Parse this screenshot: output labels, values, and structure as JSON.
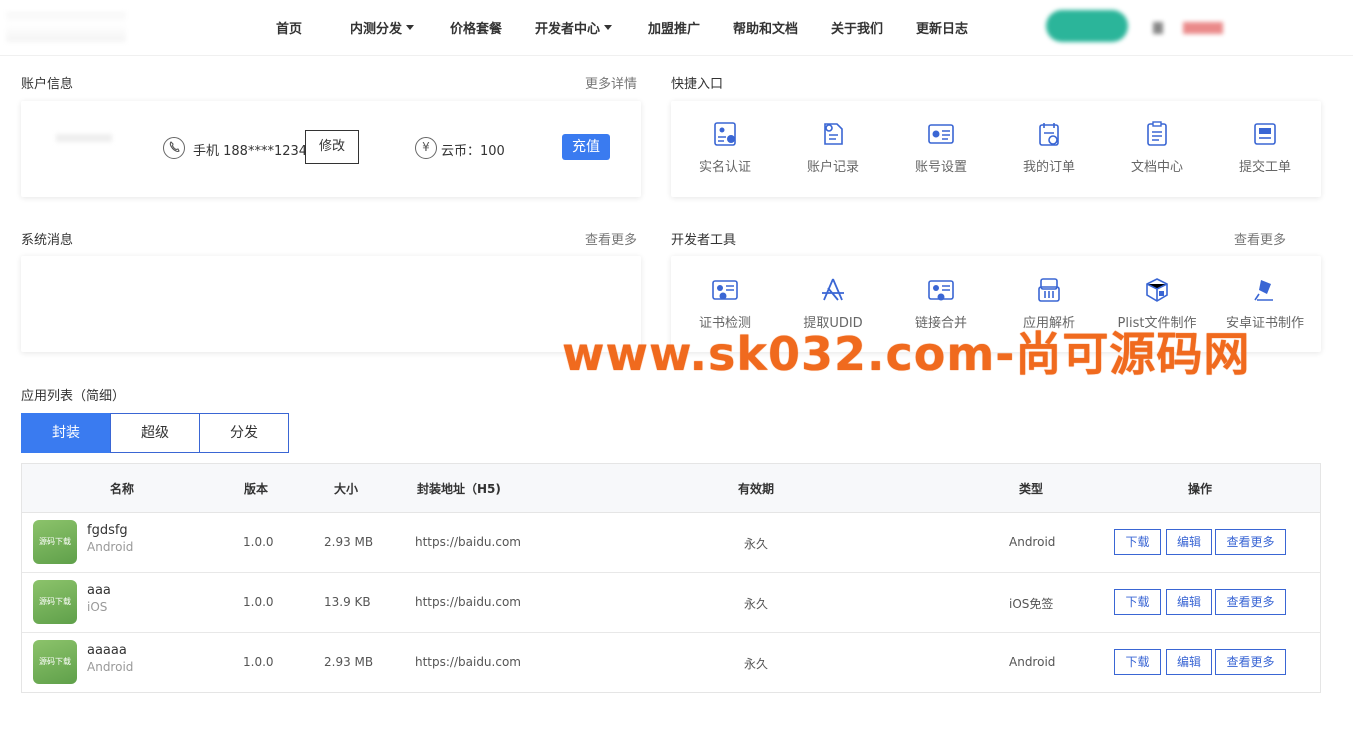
{
  "nav": {
    "items": [
      {
        "label": "首页"
      },
      {
        "label": "内测分发",
        "dropdown": true
      },
      {
        "label": "价格套餐"
      },
      {
        "label": "开发者中心",
        "dropdown": true
      },
      {
        "label": "加盟推广"
      },
      {
        "label": "帮助和文档"
      },
      {
        "label": "关于我们"
      },
      {
        "label": "更新日志"
      }
    ]
  },
  "account": {
    "title": "账户信息",
    "more": "更多详情",
    "phone_icon": "phone-icon",
    "phone_text": "手机 188****1234",
    "edit_label": "修改",
    "coin_icon": "yen-icon",
    "coin_text": "云币：100",
    "recharge_label": "充值"
  },
  "quick": {
    "title": "快捷入口",
    "items": [
      {
        "label": "实名认证",
        "icon": "id-verify-icon"
      },
      {
        "label": "账户记录",
        "icon": "account-record-icon"
      },
      {
        "label": "账号设置",
        "icon": "account-settings-icon"
      },
      {
        "label": "我的订单",
        "icon": "order-icon"
      },
      {
        "label": "文档中心",
        "icon": "document-icon"
      },
      {
        "label": "提交工单",
        "icon": "ticket-icon"
      }
    ]
  },
  "messages": {
    "title": "系统消息",
    "more": "查看更多"
  },
  "devtools": {
    "title": "开发者工具",
    "more": "查看更多",
    "items": [
      {
        "label": "证书检测",
        "icon": "certificate-check-icon"
      },
      {
        "label": "提取UDID",
        "icon": "app-store-icon"
      },
      {
        "label": "链接合并",
        "icon": "link-merge-icon"
      },
      {
        "label": "应用解析",
        "icon": "app-parse-icon"
      },
      {
        "label": "Plist文件制作",
        "icon": "plist-icon"
      },
      {
        "label": "安卓证书制作",
        "icon": "android-cert-icon"
      }
    ]
  },
  "watermark": "www.sk032.com-尚可源码网",
  "applist": {
    "title": "应用列表（简细）",
    "tabs": [
      {
        "label": "封装",
        "active": true
      },
      {
        "label": "超级"
      },
      {
        "label": "分发"
      }
    ],
    "columns": [
      "名称",
      "版本",
      "大小",
      "封装地址（H5)",
      "有效期",
      "类型",
      "操作"
    ],
    "icon_text": "源码下载",
    "actions": [
      "下载",
      "编辑",
      "查看更多"
    ],
    "rows": [
      {
        "name": "fgdsfg",
        "platform": "Android",
        "version": "1.0.0",
        "size": "2.93 MB",
        "url": "https://baidu.com",
        "expiry": "永久",
        "type": "Android"
      },
      {
        "name": "aaa",
        "platform": "iOS",
        "version": "1.0.0",
        "size": "13.9 KB",
        "url": "https://baidu.com",
        "expiry": "永久",
        "type": "iOS免签"
      },
      {
        "name": "aaaaa",
        "platform": "Android",
        "version": "1.0.0",
        "size": "2.93 MB",
        "url": "https://baidu.com",
        "expiry": "永久",
        "type": "Android"
      }
    ]
  },
  "colors": {
    "accent": "#3a7bf0",
    "watermark": "#f06a1e",
    "icon_blue": "#3a66d4"
  }
}
